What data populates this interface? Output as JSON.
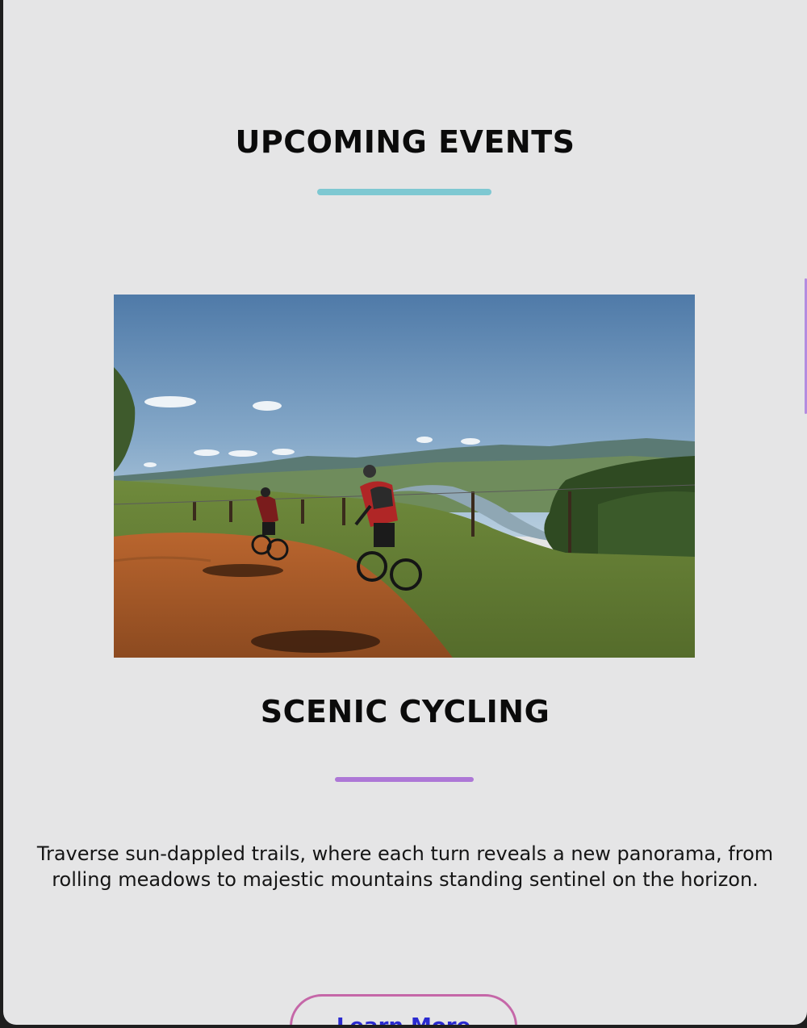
{
  "section": {
    "title": "UPCOMING EVENTS",
    "underline_color": "#7ec8d2"
  },
  "event": {
    "image_alt": "Two cyclists riding a dirt road beside a lake with green hills",
    "title": "SCENIC CYCLING",
    "underline_color": "#ad77d6",
    "description": "Traverse sun-dappled trails, where each turn reveals a new panorama, from rolling meadows to majestic mountains standing sentinel on the horizon.",
    "button_label": "Learn More"
  },
  "colors": {
    "page_background": "#e5e5e6",
    "button_border": "#c567a8",
    "button_text": "#2a2ad0"
  }
}
